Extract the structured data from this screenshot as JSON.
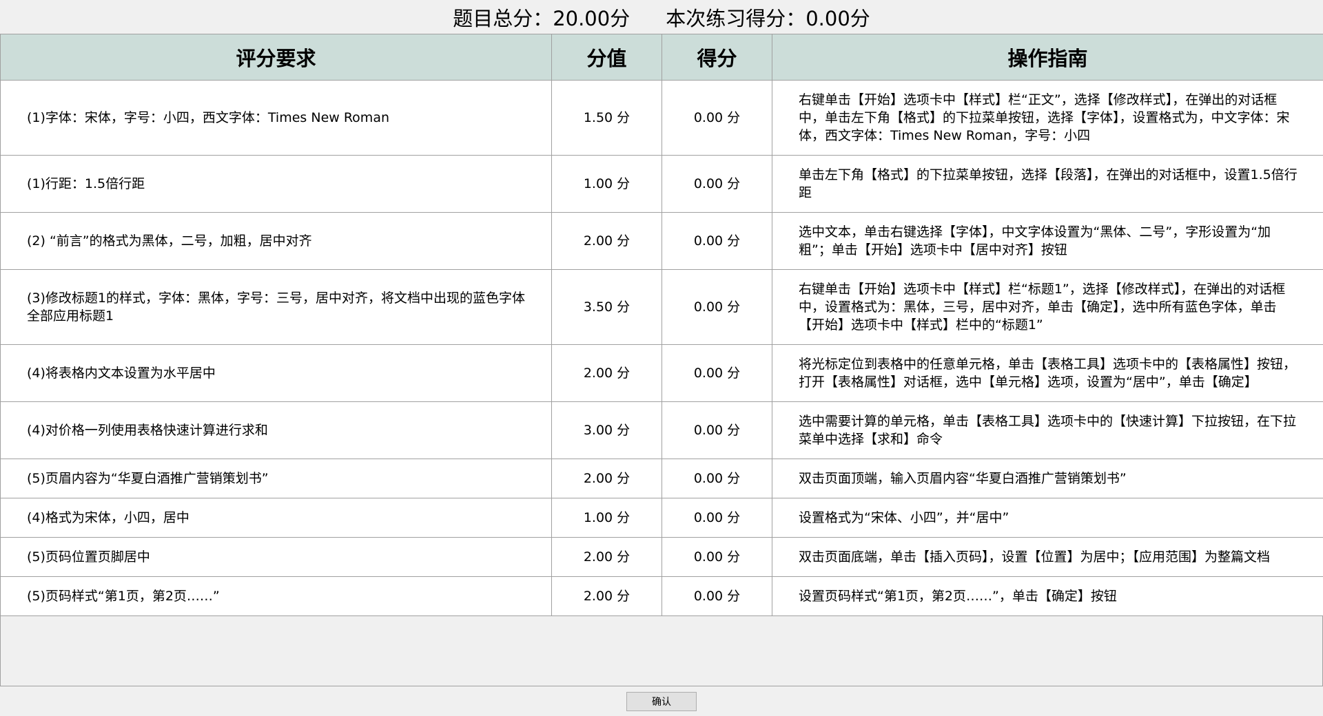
{
  "summary": {
    "total_score": "题目总分：20.00分",
    "practice_score": "本次练习得分：0.00分"
  },
  "table": {
    "headers": [
      "评分要求",
      "分值",
      "得分",
      "操作指南"
    ],
    "rows": [
      {
        "requirement": "(1)字体：宋体，字号：小四，西文字体：Times New Roman",
        "value": "1.50 分",
        "score": "0.00 分",
        "guide": "右键单击【开始】选项卡中【样式】栏“正文”，选择【修改样式】，在弹出的对话框中，单击左下角【格式】的下拉菜单按钮，选择【字体】，设置格式为，中文字体：宋体，西文字体：Times New Roman，字号：小四"
      },
      {
        "requirement": "(1)行距：1.5倍行距",
        "value": "1.00 分",
        "score": "0.00 分",
        "guide": "单击左下角【格式】的下拉菜单按钮，选择【段落】，在弹出的对话框中，设置1.5倍行距"
      },
      {
        "requirement": "(2) “前言”的格式为黑体，二号，加粗，居中对齐",
        "value": "2.00 分",
        "score": "0.00 分",
        "guide": "选中文本，单击右键选择【字体】，中文字体设置为“黑体、二号”，字形设置为“加粗”；单击【开始】选项卡中【居中对齐】按钮"
      },
      {
        "requirement": "(3)修改标题1的样式，字体：黑体，字号：三号，居中对齐，将文档中出现的蓝色字体全部应用标题1",
        "value": "3.50 分",
        "score": "0.00 分",
        "guide": "右键单击【开始】选项卡中【样式】栏“标题1”，选择【修改样式】，在弹出的对话框中，设置格式为：黑体，三号，居中对齐，单击【确定】，选中所有蓝色字体，单击【开始】选项卡中【样式】栏中的“标题1”"
      },
      {
        "requirement": "(4)将表格内文本设置为水平居中",
        "value": "2.00 分",
        "score": "0.00 分",
        "guide": "将光标定位到表格中的任意单元格，单击【表格工具】选项卡中的【表格属性】按钮，打开【表格属性】对话框，选中【单元格】选项，设置为“居中”，单击【确定】"
      },
      {
        "requirement": "(4)对价格一列使用表格快速计算进行求和",
        "value": "3.00 分",
        "score": "0.00 分",
        "guide": "选中需要计算的单元格，单击【表格工具】选项卡中的【快速计算】下拉按钮，在下拉菜单中选择【求和】命令"
      },
      {
        "requirement": "(5)页眉内容为“华夏白酒推广营销策划书”",
        "value": "2.00 分",
        "score": "0.00 分",
        "guide": "双击页面顶端，输入页眉内容“华夏白酒推广营销策划书”"
      },
      {
        "requirement": "(4)格式为宋体，小四，居中",
        "value": "1.00 分",
        "score": "0.00 分",
        "guide": "设置格式为“宋体、小四”，并“居中”"
      },
      {
        "requirement": "(5)页码位置页脚居中",
        "value": "2.00 分",
        "score": "0.00 分",
        "guide": "双击页面底端，单击【插入页码】，设置【位置】为居中；【应用范围】为整篇文档"
      },
      {
        "requirement": "(5)页码样式“第1页，第2页……”",
        "value": "2.00 分",
        "score": "0.00 分",
        "guide": "设置页码样式“第1页，第2页……”，单击【确定】按钮"
      }
    ]
  },
  "footer": {
    "confirm_label": "确认"
  },
  "colors": {
    "header_bg": "#ccddd9",
    "grid_line": "#a0a0a0",
    "window_bg": "#f0f0f0"
  }
}
